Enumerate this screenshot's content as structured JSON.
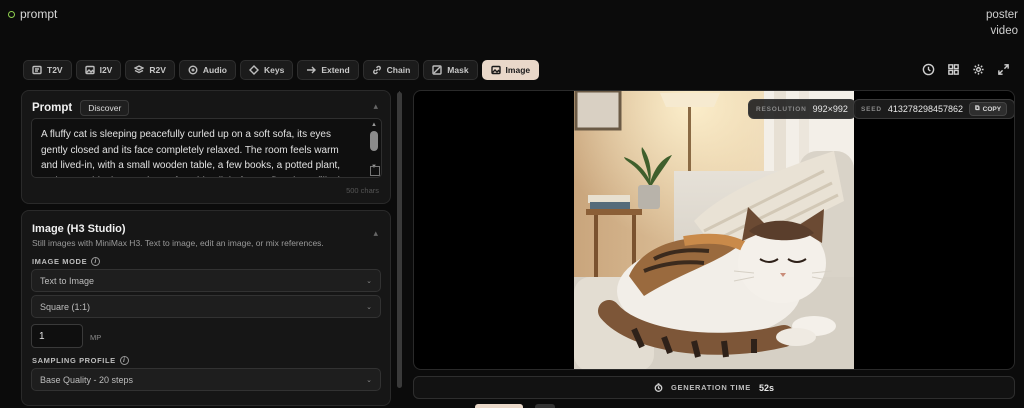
{
  "app": {
    "title": "prompt"
  },
  "header_links": [
    "poster",
    "video"
  ],
  "tabs": [
    {
      "label": "T2V",
      "icon": "text-box-icon"
    },
    {
      "label": "I2V",
      "icon": "image-icon"
    },
    {
      "label": "R2V",
      "icon": "layers-icon"
    },
    {
      "label": "Audio",
      "icon": "audio-icon"
    },
    {
      "label": "Keys",
      "icon": "diamond-icon"
    },
    {
      "label": "Extend",
      "icon": "arrow-right-icon"
    },
    {
      "label": "Chain",
      "icon": "link-icon"
    },
    {
      "label": "Mask",
      "icon": "mask-icon"
    },
    {
      "label": "Image",
      "icon": "image-icon",
      "active": true
    }
  ],
  "toolbar_icons": [
    "history-icon",
    "grid-icon",
    "settings-icon",
    "expand-icon"
  ],
  "prompt": {
    "title": "Prompt",
    "discover_label": "Discover",
    "text": "A fluffy cat is sleeping peacefully curled up on a soft sofa, its eyes gently closed and its face completely relaxed. The room feels warm and lived-in, with a small wooden table, a few books, a potted plant, and a cozy blanket nearby. Soft, golden light from a floor lamp fills the space with",
    "char_count": "500 chars"
  },
  "image_panel": {
    "title": "Image (H3 Studio)",
    "description": "Still images with MiniMax H3. Text to image, edit an image, or mix references.",
    "image_mode_label": "IMAGE MODE",
    "image_mode_value": "Text to Image",
    "aspect_value": "Square (1:1)",
    "mp_value": "1",
    "mp_unit": "MP",
    "sampling_label": "SAMPLING PROFILE",
    "sampling_value": "Base Quality - 20 steps"
  },
  "canvas": {
    "resolution_label": "RESOLUTION",
    "resolution_value": "992×992",
    "seed_label": "SEED",
    "seed_value": "413278298457862",
    "copy_label": "COPY"
  },
  "generation": {
    "label": "GENERATION TIME",
    "value": "52s"
  },
  "colors": {
    "accent": "#e9d8c9",
    "background": "#0b0b0b",
    "panel": "#161616",
    "status_dot": "#8fd14f"
  }
}
